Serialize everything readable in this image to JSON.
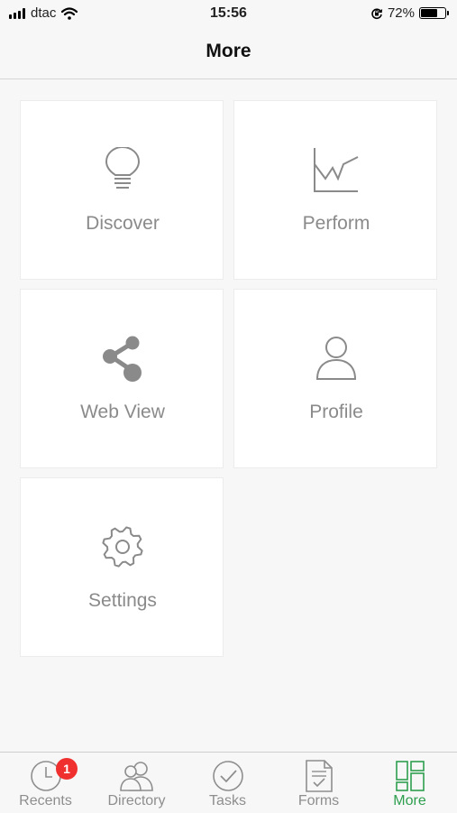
{
  "status_bar": {
    "carrier": "dtac",
    "time": "15:56",
    "battery_percent": "72%",
    "battery_level": 0.72,
    "icons": [
      "signal-icon",
      "wifi-icon",
      "orientation-lock-icon",
      "battery-icon"
    ]
  },
  "nav": {
    "title": "More"
  },
  "tiles": [
    {
      "label": "Discover",
      "icon": "lightbulb-icon"
    },
    {
      "label": "Perform",
      "icon": "line-chart-icon"
    },
    {
      "label": "Web View",
      "icon": "share-icon"
    },
    {
      "label": "Profile",
      "icon": "person-icon"
    },
    {
      "label": "Settings",
      "icon": "gear-icon"
    }
  ],
  "tab_bar": {
    "tabs": [
      {
        "label": "Recents",
        "icon": "clock-icon",
        "badge": "1"
      },
      {
        "label": "Directory",
        "icon": "people-icon"
      },
      {
        "label": "Tasks",
        "icon": "checkmark-circle-icon"
      },
      {
        "label": "Forms",
        "icon": "form-document-icon"
      },
      {
        "label": "More",
        "icon": "grid-icon",
        "active": true
      }
    ]
  },
  "colors": {
    "active_tab": "#2e9e4f",
    "badge": "#f0302e",
    "tile_label": "#8a8a8a",
    "icon_gray": "#8a8a8a"
  }
}
